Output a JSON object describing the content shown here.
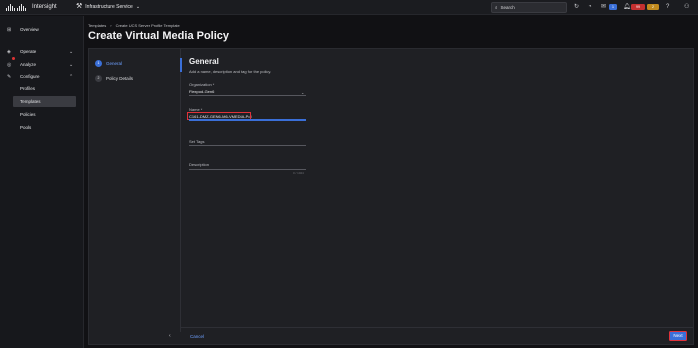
{
  "header": {
    "brand": "Intersight",
    "service": "Infrastructure Service",
    "search_placeholder": "Search",
    "badges": {
      "notifications": "1",
      "alarms_critical": "99",
      "alarms_warning": "2"
    }
  },
  "sidebar": {
    "items": [
      {
        "label": "Overview",
        "icon": "grid-icon"
      },
      {
        "label": "Operate",
        "icon": "operate-icon"
      },
      {
        "label": "Analyze",
        "icon": "analyze-icon"
      },
      {
        "label": "Configure",
        "icon": "wrench-icon"
      }
    ],
    "configure_children": [
      "Profiles",
      "Templates",
      "Policies",
      "Pools"
    ],
    "active": "Templates"
  },
  "breadcrumb": [
    "Templates",
    "Create UCS Server Profile Template"
  ],
  "page_title": "Create Virtual Media Policy",
  "steps": [
    {
      "num": "1",
      "label": "General"
    },
    {
      "num": "2",
      "label": "Policy Details"
    }
  ],
  "form": {
    "title": "General",
    "description": "Add a name, description and tag for the policy.",
    "organization_label": "Organization *",
    "organization_value": "Flexpod-Gen6",
    "name_label": "Name *",
    "name_value": "C161-DMZ-GEN6-M6-VMEDIA-Pol",
    "tags_label": "Set Tags",
    "description_label": "Description",
    "description_count": "0 / 1024"
  },
  "footer": {
    "cancel": "Cancel",
    "next": "Next"
  },
  "colors": {
    "accent": "#3a6fd8",
    "highlight": "#e0323a"
  }
}
